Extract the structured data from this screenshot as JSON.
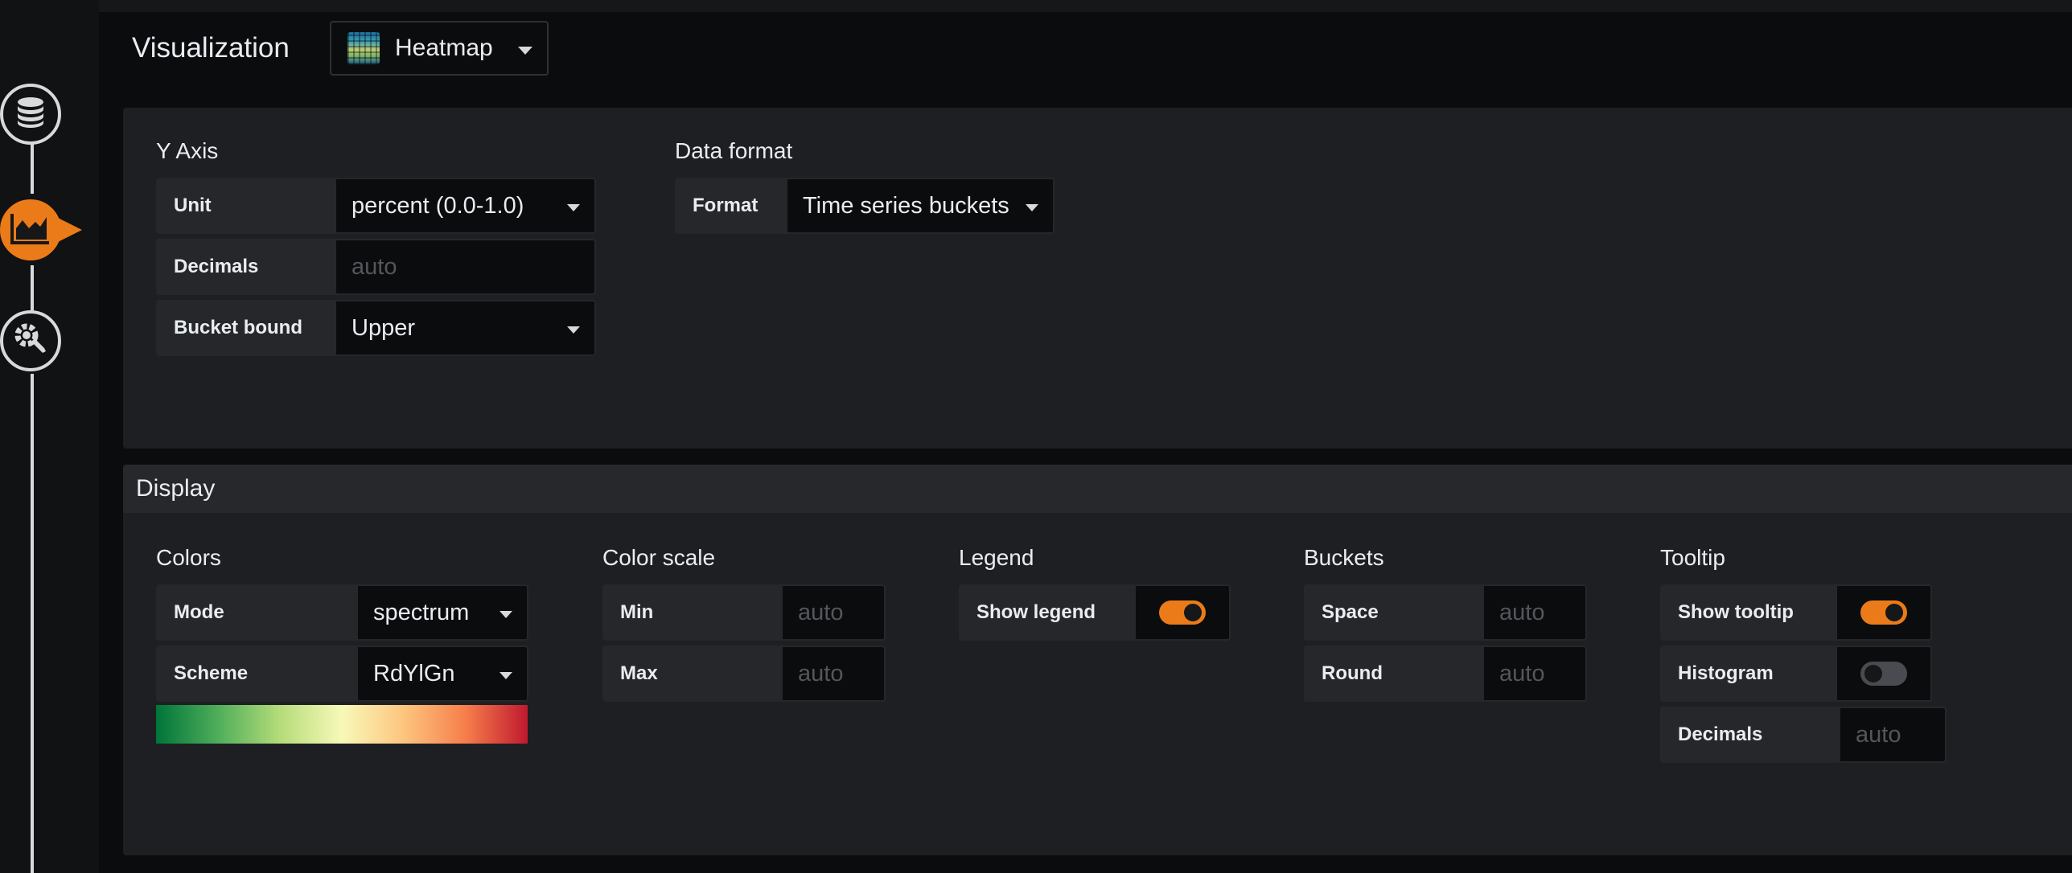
{
  "header": {
    "title": "Visualization",
    "picker_value": "Heatmap"
  },
  "rail": {
    "items": [
      "queries",
      "visualization",
      "general"
    ],
    "active": "visualization"
  },
  "axes": {
    "y_axis": {
      "title": "Y Axis",
      "unit_label": "Unit",
      "unit_value": "percent (0.0-1.0)",
      "decimals_label": "Decimals",
      "decimals_placeholder": "auto",
      "bucket_bound_label": "Bucket bound",
      "bucket_bound_value": "Upper"
    },
    "data_format": {
      "title": "Data format",
      "format_label": "Format",
      "format_value": "Time series buckets"
    }
  },
  "display": {
    "header": "Display",
    "colors": {
      "title": "Colors",
      "mode_label": "Mode",
      "mode_value": "spectrum",
      "scheme_label": "Scheme",
      "scheme_value": "RdYlGn",
      "scheme_stops": [
        "#00743a",
        "#4fae5a",
        "#b5dc79",
        "#f8f9b8",
        "#fdc57f",
        "#f67e4b",
        "#c0192e"
      ]
    },
    "color_scale": {
      "title": "Color scale",
      "min_label": "Min",
      "min_placeholder": "auto",
      "max_label": "Max",
      "max_placeholder": "auto"
    },
    "legend": {
      "title": "Legend",
      "show_legend_label": "Show legend",
      "show_legend": true
    },
    "buckets": {
      "title": "Buckets",
      "space_label": "Space",
      "space_placeholder": "auto",
      "round_label": "Round",
      "round_placeholder": "auto"
    },
    "tooltip": {
      "title": "Tooltip",
      "show_tooltip_label": "Show tooltip",
      "show_tooltip": true,
      "histogram_label": "Histogram",
      "histogram": false,
      "decimals_label": "Decimals",
      "decimals_placeholder": "auto"
    }
  },
  "colors": {
    "accent": "#eb7b18",
    "panel": "#1e1f22",
    "input": "#0b0c0e",
    "label": "#26272b"
  }
}
